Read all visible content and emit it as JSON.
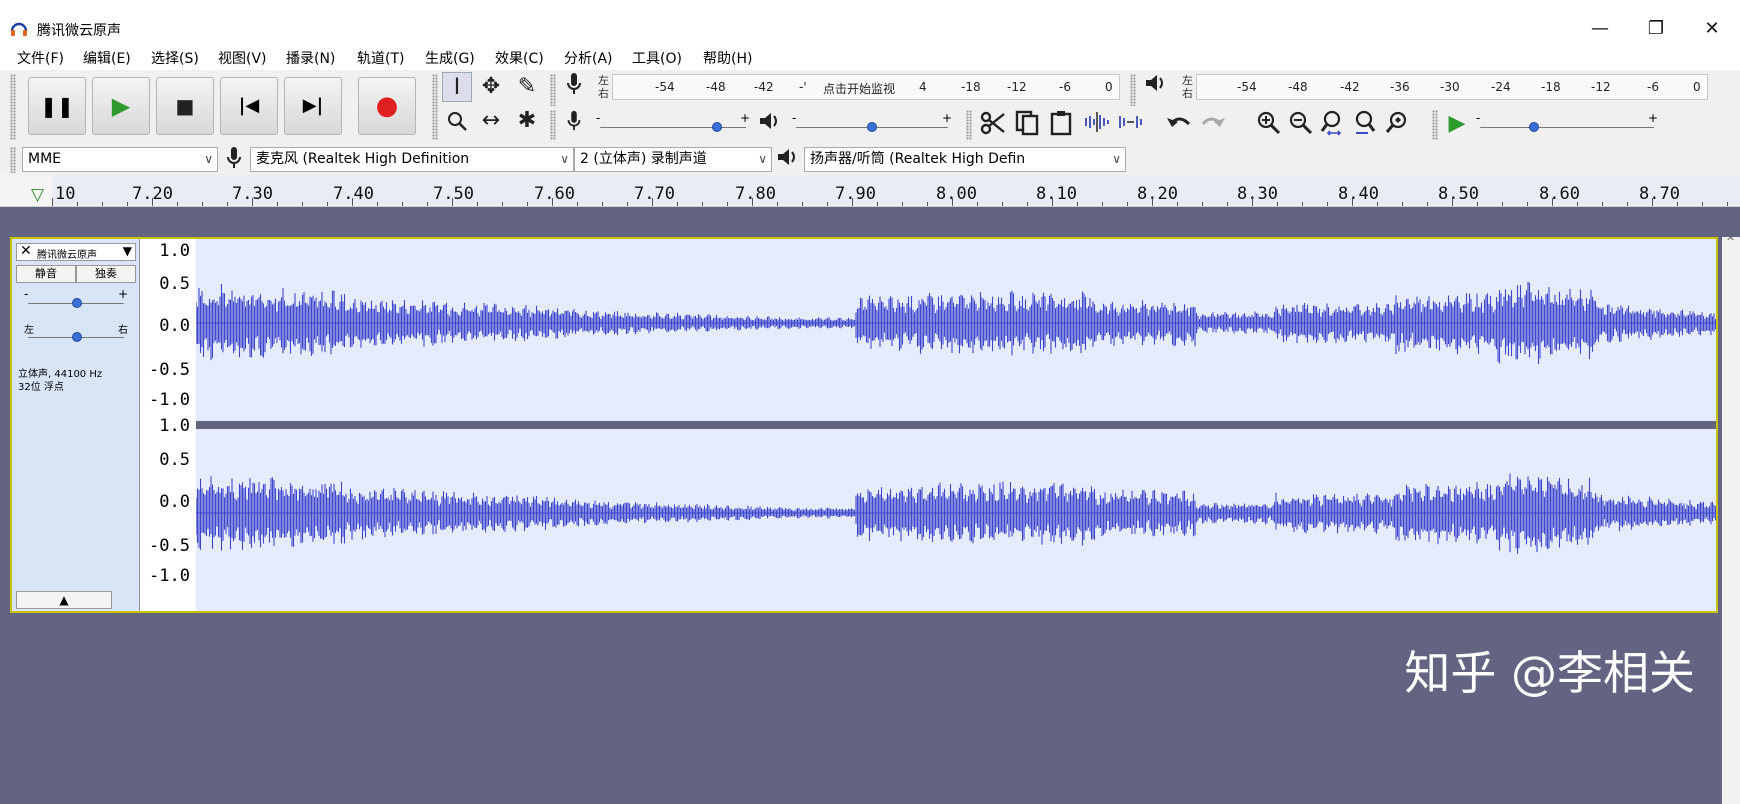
{
  "window": {
    "title": "腾讯微云原声",
    "minimize": "—",
    "restore": "❐",
    "close": "✕"
  },
  "menu": [
    "文件(F)",
    "编辑(E)",
    "选择(S)",
    "视图(V)",
    "播录(N)",
    "轨道(T)",
    "生成(G)",
    "效果(C)",
    "分析(A)",
    "工具(O)",
    "帮助(H)"
  ],
  "transport": {
    "pause": "❚❚",
    "play": "▶",
    "stop": "■",
    "skip_start": "|◀",
    "skip_end": "▶|",
    "record": "●"
  },
  "tools": {
    "select": "I",
    "envelope": "✥",
    "draw": "✎",
    "zoom": "🔍",
    "timeshift": "↔",
    "multi": "✱"
  },
  "record_meter": {
    "lr_top": "左",
    "lr_bottom": "右",
    "ticks": [
      "-54",
      "-48",
      "-42",
      "-'",
      "点击开始监视",
      "4",
      "-18",
      "-12",
      "-6",
      "0"
    ]
  },
  "play_meter": {
    "lr_top": "左",
    "lr_bottom": "右",
    "ticks": [
      "-54",
      "-48",
      "-42",
      "-36",
      "-30",
      "-24",
      "-18",
      "-12",
      "-6",
      "0"
    ]
  },
  "sliders": {
    "rec_min": "-",
    "rec_max": "+",
    "play_min": "-",
    "play_max": "+",
    "speed_min": "-",
    "speed_max": "+",
    "rec_volume": 0.82,
    "play_volume": 0.5,
    "play_speed": 0.3
  },
  "devices": {
    "host": "MME",
    "input": "麦克风 (Realtek High Definition",
    "channels": "2 (立体声) 录制声道",
    "output": "扬声器/听筒 (Realtek High Defin"
  },
  "ruler": {
    "first_label": "10",
    "labels": [
      "7.20",
      "7.30",
      "7.40",
      "7.50",
      "7.60",
      "7.70",
      "7.80",
      "7.90",
      "8.00",
      "8.10",
      "8.20",
      "8.30",
      "8.40",
      "8.50",
      "8.60",
      "8.70"
    ]
  },
  "track": {
    "name": "腾讯微云原声",
    "mute": "静音",
    "solo": "独奏",
    "gain_min": "-",
    "gain_max": "+",
    "pan_left": "左",
    "pan_right": "右",
    "info_line1": "立体声, 44100 Hz",
    "info_line2": "32位 浮点",
    "collapse": "▲",
    "scale": [
      "1.0",
      "0.5",
      "0.0",
      "-0.5",
      "-1.0"
    ]
  },
  "colors": {
    "wave": "#3e46cc",
    "wave_bg": "#e6ecff",
    "track_border": "#c9c300",
    "background": "#626482"
  },
  "watermark": "知乎 @李相关"
}
